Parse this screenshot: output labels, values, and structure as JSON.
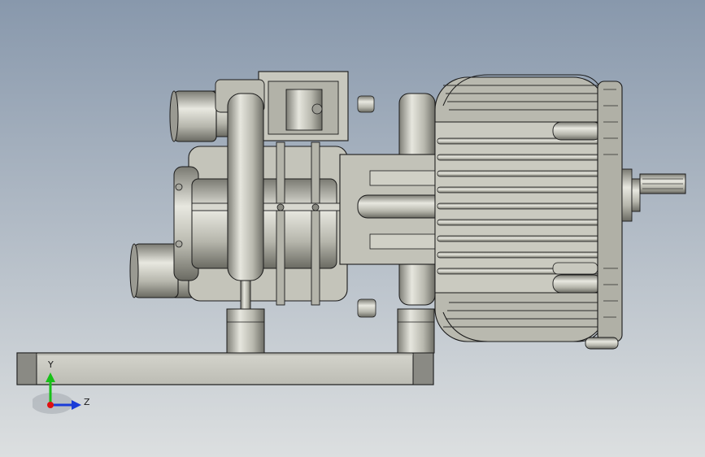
{
  "viewport": {
    "colors": {
      "background_top": "#8898ac",
      "background_bottom": "#dcdfe0",
      "part_fill": "#c6c6bc",
      "part_shade": "#8e8e86",
      "edge": "#1a1a1a",
      "base_plate": "#c9c9c1"
    }
  },
  "triad": {
    "y_label": "Y",
    "z_label": "Z",
    "colors": {
      "y": "#18c018",
      "z": "#1a3cd8",
      "x": "#e01010"
    }
  }
}
